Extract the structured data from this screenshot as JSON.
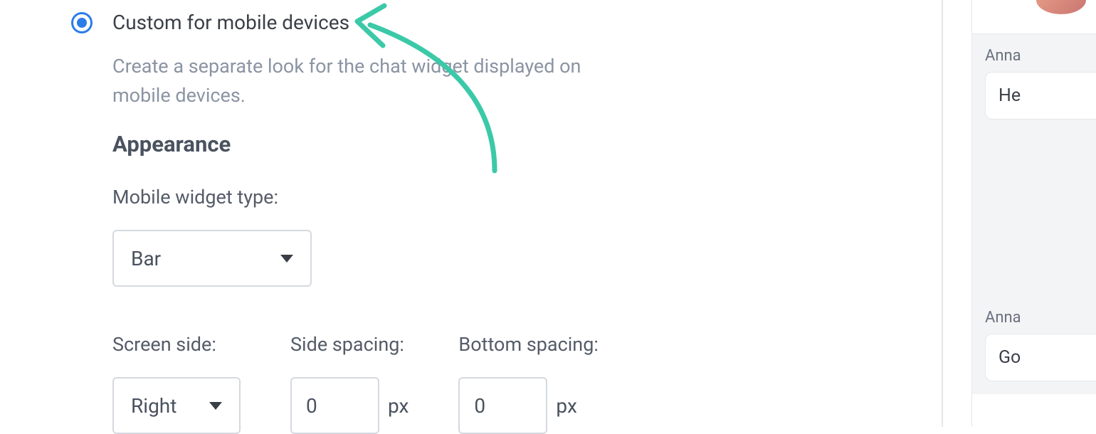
{
  "settings": {
    "radio": {
      "label": "Custom for mobile devices",
      "description": "Create a separate look for the chat widget displayed on mobile devices."
    },
    "appearance": {
      "heading": "Appearance",
      "widget_type": {
        "label": "Mobile widget type:",
        "value": "Bar"
      },
      "screen_side": {
        "label": "Screen side:",
        "value": "Right"
      },
      "side_spacing": {
        "label": "Side spacing:",
        "value": "0",
        "unit": "px"
      },
      "bottom_spacing": {
        "label": "Bottom spacing:",
        "value": "0",
        "unit": "px"
      }
    }
  },
  "chat": {
    "msg1": {
      "sender": "Anna",
      "text": "He"
    },
    "msg2": {
      "sender": "Anna",
      "text": "Go"
    }
  }
}
